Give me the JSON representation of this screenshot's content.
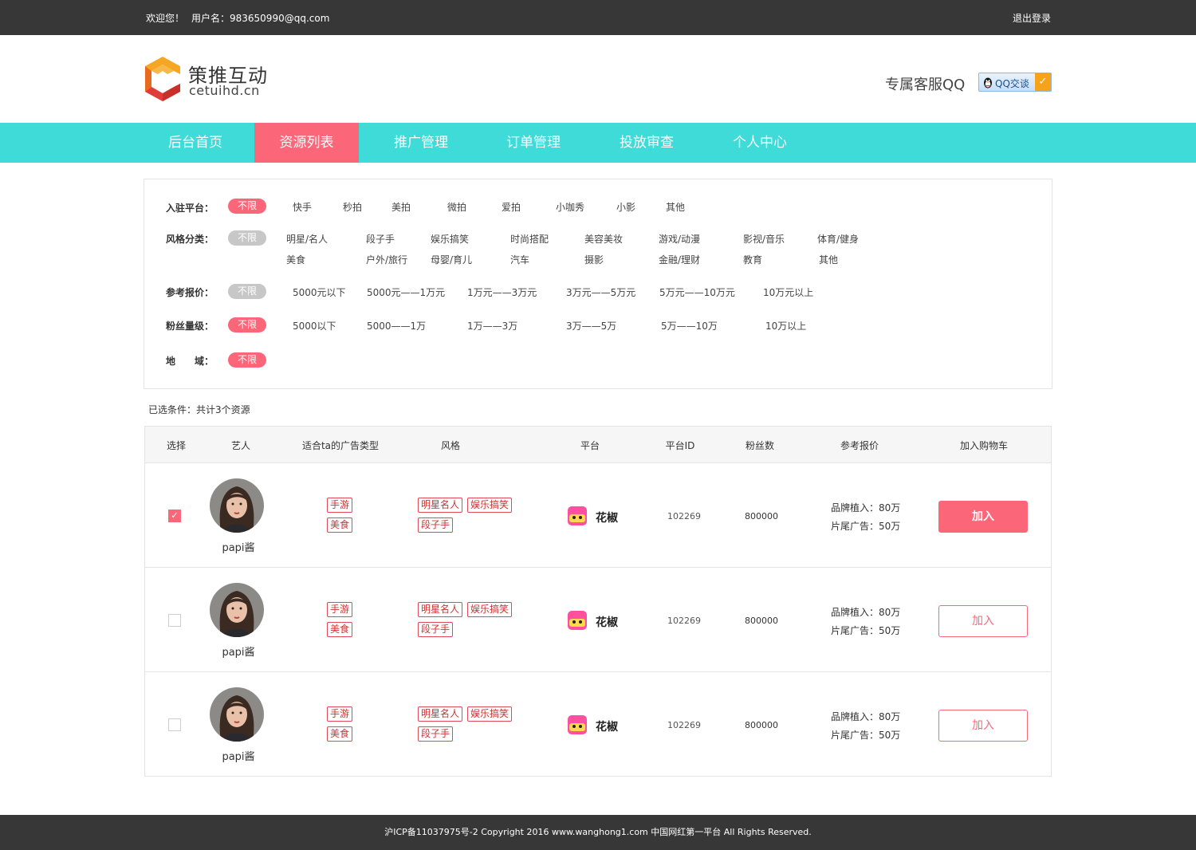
{
  "topbar": {
    "welcome": "欢迎您！",
    "user": "用户名：983650990@qq.com",
    "logout": "退出登录"
  },
  "header": {
    "logo_cn": "策推互动",
    "logo_en": "cetuihd.cn",
    "qq_label": "专属客服QQ",
    "qq_button": "QQ交谈",
    "brand_colors": {
      "orange": "#f5a623",
      "red": "#e23b3b"
    }
  },
  "nav": {
    "items": [
      {
        "label": "后台首页"
      },
      {
        "label": "资源列表"
      },
      {
        "label": "推广管理"
      },
      {
        "label": "订单管理"
      },
      {
        "label": "投放审查"
      },
      {
        "label": "个人中心"
      }
    ],
    "active_index": 1,
    "colors": {
      "bar": "#3fdbd8",
      "active": "#fb6779"
    }
  },
  "filters": {
    "platform": {
      "label": "入驻平台：",
      "all": "不限",
      "options": [
        "快手",
        "秒拍",
        "美拍",
        "微拍",
        "爱拍",
        "小咖秀",
        "小影",
        "其他"
      ]
    },
    "style": {
      "label": "风格分类：",
      "all": "不限",
      "row1": [
        "明星/名人",
        "段子手",
        "娱乐搞笑",
        "时尚搭配",
        "美容美妆",
        "游戏/动漫",
        "影视/音乐",
        "体育/健身"
      ],
      "row2": [
        "美食",
        "户外/旅行",
        "母婴/育儿",
        "汽车",
        "摄影",
        "金融/理财",
        "教育",
        "其他"
      ]
    },
    "price": {
      "label": "参考报价：",
      "all": "不限",
      "options": [
        "5000元以下",
        "5000元——1万元",
        "1万元——3万元",
        "3万元——5万元",
        "5万元——10万元",
        "10万元以上"
      ]
    },
    "fans": {
      "label": "粉丝量级：",
      "all": "不限",
      "options": [
        "5000以下",
        "5000——1万",
        "1万——3万",
        "3万——5万",
        "5万——10万",
        "10万以上"
      ]
    },
    "region": {
      "label": "地　　域：",
      "all": "不限"
    }
  },
  "summary": "已选条件：共计3个资源",
  "table": {
    "headers": [
      "选择",
      "艺人",
      "适合ta的广告类型",
      "风格",
      "平台",
      "平台ID",
      "粉丝数",
      "参考报价",
      "加入购物车"
    ],
    "rows": [
      {
        "checked": true,
        "name": "papi酱",
        "ad_types": [
          "手游",
          "美食"
        ],
        "styles": [
          "明星名人",
          "娱乐搞笑",
          "段子手"
        ],
        "platform": "花椒",
        "platform_id": "102269",
        "fans": "800000",
        "price1": "品牌植入：80万",
        "price2": "片尾广告：50万",
        "button": "加入",
        "button_style": "filled"
      },
      {
        "checked": false,
        "name": "papi酱",
        "ad_types": [
          "手游",
          "美食"
        ],
        "styles": [
          "明星名人",
          "娱乐搞笑",
          "段子手"
        ],
        "platform": "花椒",
        "platform_id": "102269",
        "fans": "800000",
        "price1": "品牌植入：80万",
        "price2": "片尾广告：50万",
        "button": "加入",
        "button_style": "outline"
      },
      {
        "checked": false,
        "name": "papi酱",
        "ad_types": [
          "手游",
          "美食"
        ],
        "styles": [
          "明星名人",
          "娱乐搞笑",
          "段子手"
        ],
        "platform": "花椒",
        "platform_id": "102269",
        "fans": "800000",
        "price1": "品牌植入：80万",
        "price2": "片尾广告：50万",
        "button": "加入",
        "button_style": "outline"
      }
    ]
  },
  "footer": {
    "text": "沪ICP备11037975号-2 Copyright 2016 www.wanghong1.com 中国网红第一平台 All Rights Reserved."
  }
}
